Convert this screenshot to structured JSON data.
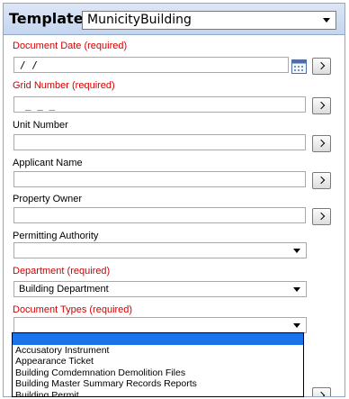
{
  "header": {
    "label": "Template:",
    "selected": "MunicityBuilding"
  },
  "fields": {
    "document_date": {
      "label": "Document Date (required)",
      "value": " / /"
    },
    "grid_number": {
      "label": "Grid Number (required)",
      "value": "_ _   _"
    },
    "unit_number": {
      "label": "Unit Number",
      "value": ""
    },
    "applicant_name": {
      "label": "Applicant Name",
      "value": ""
    },
    "property_owner": {
      "label": "Property Owner",
      "value": ""
    },
    "permitting_authority": {
      "label": "Permitting Authority",
      "value": ""
    },
    "department": {
      "label": "Department (required)",
      "value": "Building Department"
    },
    "document_types": {
      "label": "Document Types (required)",
      "value": ""
    }
  },
  "dropdown": {
    "options": [
      "",
      "Accusatory Instrument",
      "Appearance Ticket",
      "Building Comdemnation Demolition Files",
      "Building Master Summary Records Reports",
      "Building Permit"
    ]
  },
  "colors": {
    "required": "#d40000",
    "highlight": "#1a73e8",
    "header_bg": "#c5d5ef"
  }
}
